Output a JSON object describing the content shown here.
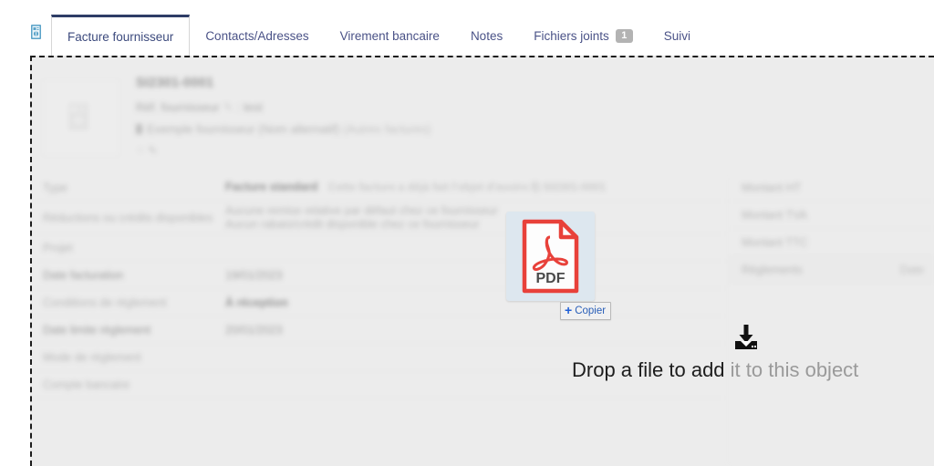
{
  "tabbar": {
    "doc_icon": "document-icon",
    "tabs": [
      {
        "label": "Facture fournisseur",
        "active": true,
        "badge": null
      },
      {
        "label": "Contacts/Adresses",
        "active": false,
        "badge": null
      },
      {
        "label": "Virement bancaire",
        "active": false,
        "badge": null
      },
      {
        "label": "Notes",
        "active": false,
        "badge": null
      },
      {
        "label": "Fichiers joints",
        "active": false,
        "badge": "1"
      },
      {
        "label": "Suivi",
        "active": false,
        "badge": null
      }
    ]
  },
  "record": {
    "title": "SI2301-0001",
    "ref_label": "Réf. fournisseur",
    "ref_pencil": "✎",
    "ref_sep": ":",
    "ref_value": "test",
    "supplier_name": "Exemple fournisseur (Nom alternatif)",
    "supplier_extra": "(Autres factures)",
    "tags": "⁘ ✎"
  },
  "form": {
    "left_rows": [
      {
        "label": "Type",
        "value": "Facture standard",
        "value_strong": true,
        "sub": "Cette facture a déjà fait l'objet d'avoirs ⎘ SI2301-0001"
      },
      {
        "label": "Réductions ou crédits disponibles",
        "line1": "Aucune remise relative par défaut chez ce fournisseur",
        "line2": "Aucun rabais/crédit disponible chez ce fournisseur"
      },
      {
        "label": "Projet",
        "value": ""
      },
      {
        "label": "Date facturation",
        "value": "19/01/2023"
      },
      {
        "label": "Conditions de règlement",
        "value": "À réception",
        "value_strong": true
      },
      {
        "label": "Date limite règlement",
        "value": "20/01/2023"
      },
      {
        "label": "Mode de règlement",
        "value": ""
      },
      {
        "label": "Compte bancaire",
        "value": ""
      }
    ],
    "right_rows": [
      {
        "label": "Montant HT",
        "value": ""
      },
      {
        "label": "Montant TVA",
        "value": ""
      },
      {
        "label": "Montant TTC",
        "value": ""
      },
      {
        "label": "Règlements",
        "value": "Date",
        "header": true
      }
    ]
  },
  "drop": {
    "message_strong": "Drop a file to add",
    "message_muted": " it to this object",
    "download_icon": "download-icon"
  },
  "drag": {
    "file_type_label": "PDF",
    "file_icon": "pdf-file-icon",
    "badge_plus": "+",
    "badge_label": "Copier"
  },
  "colors": {
    "accent_tab": "#2e3d66",
    "tab_text": "#4a5287",
    "pdf_red": "#e8413a",
    "badge_blue": "#2a5fb8",
    "panel_bg": "#ececec"
  }
}
